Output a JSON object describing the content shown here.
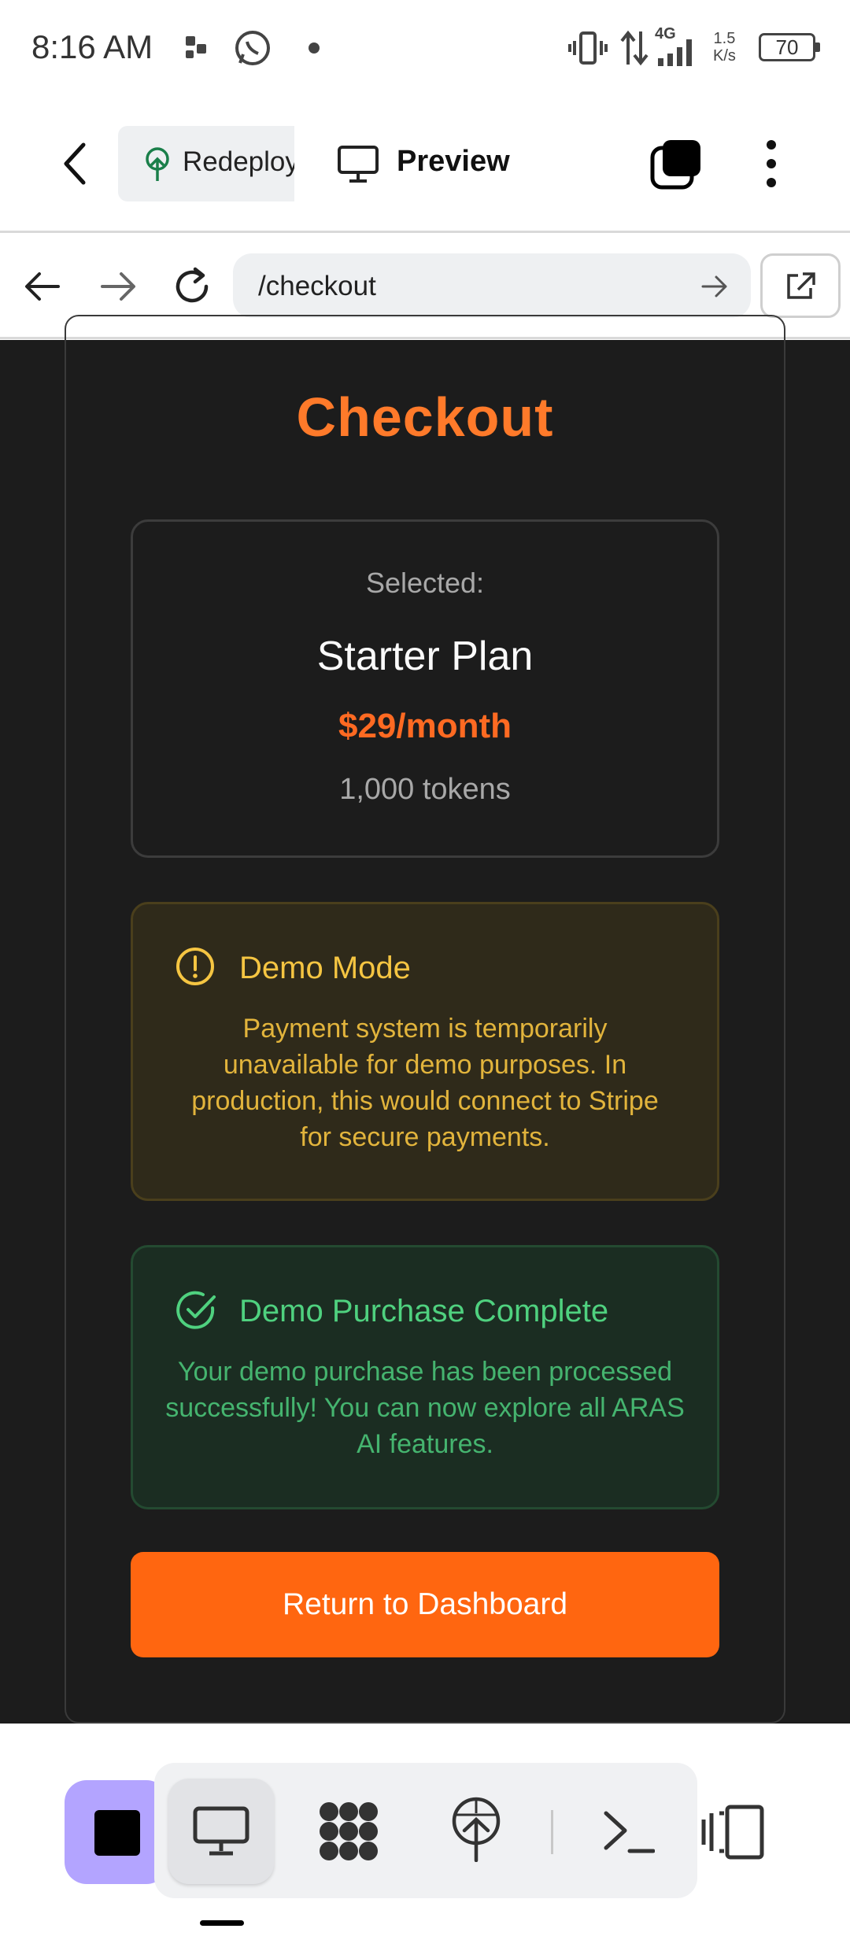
{
  "status_bar": {
    "time": "8:16 AM",
    "network": "4G",
    "speed_value": "1.5",
    "speed_unit": "K/s",
    "battery": "70"
  },
  "topbar": {
    "redeploy_label": "Redeploy",
    "preview_label": "Preview"
  },
  "url_bar": {
    "path": "/checkout"
  },
  "checkout": {
    "title": "Checkout",
    "selected_label": "Selected:",
    "plan_name": "Starter Plan",
    "plan_price": "$29/month",
    "plan_tokens": "1,000 tokens",
    "demo_notice": {
      "title": "Demo Mode",
      "body": "Payment system is temporarily unavailable for demo purposes. In production, this would connect to Stripe for secure payments."
    },
    "success_notice": {
      "title": "Demo Purchase Complete",
      "body": "Your demo purchase has been processed successfully! You can now explore all ARAS AI features."
    },
    "return_button": "Return to Dashboard"
  },
  "colors": {
    "accent_orange": "#ff6610",
    "warning_yellow": "#f5c542",
    "success_green": "#4fd17f",
    "stop_purple": "#b3a4ff"
  },
  "icons": {
    "back": "chevron-left-icon",
    "redeploy": "deploy-tree-icon",
    "preview": "monitor-icon",
    "tabs": "tabs-icon",
    "menu": "kebab-menu-icon",
    "nav_back": "arrow-left-icon",
    "nav_forward": "arrow-right-icon",
    "reload": "reload-icon",
    "go": "arrow-right-icon",
    "open_external": "external-link-icon",
    "warning": "alert-circle-icon",
    "success": "check-circle-icon",
    "stop": "stop-icon",
    "desktop": "monitor-icon",
    "nodes": "nodes-icon",
    "deploy": "deploy-tree-icon",
    "terminal": "terminal-icon",
    "panel": "panel-icon"
  }
}
